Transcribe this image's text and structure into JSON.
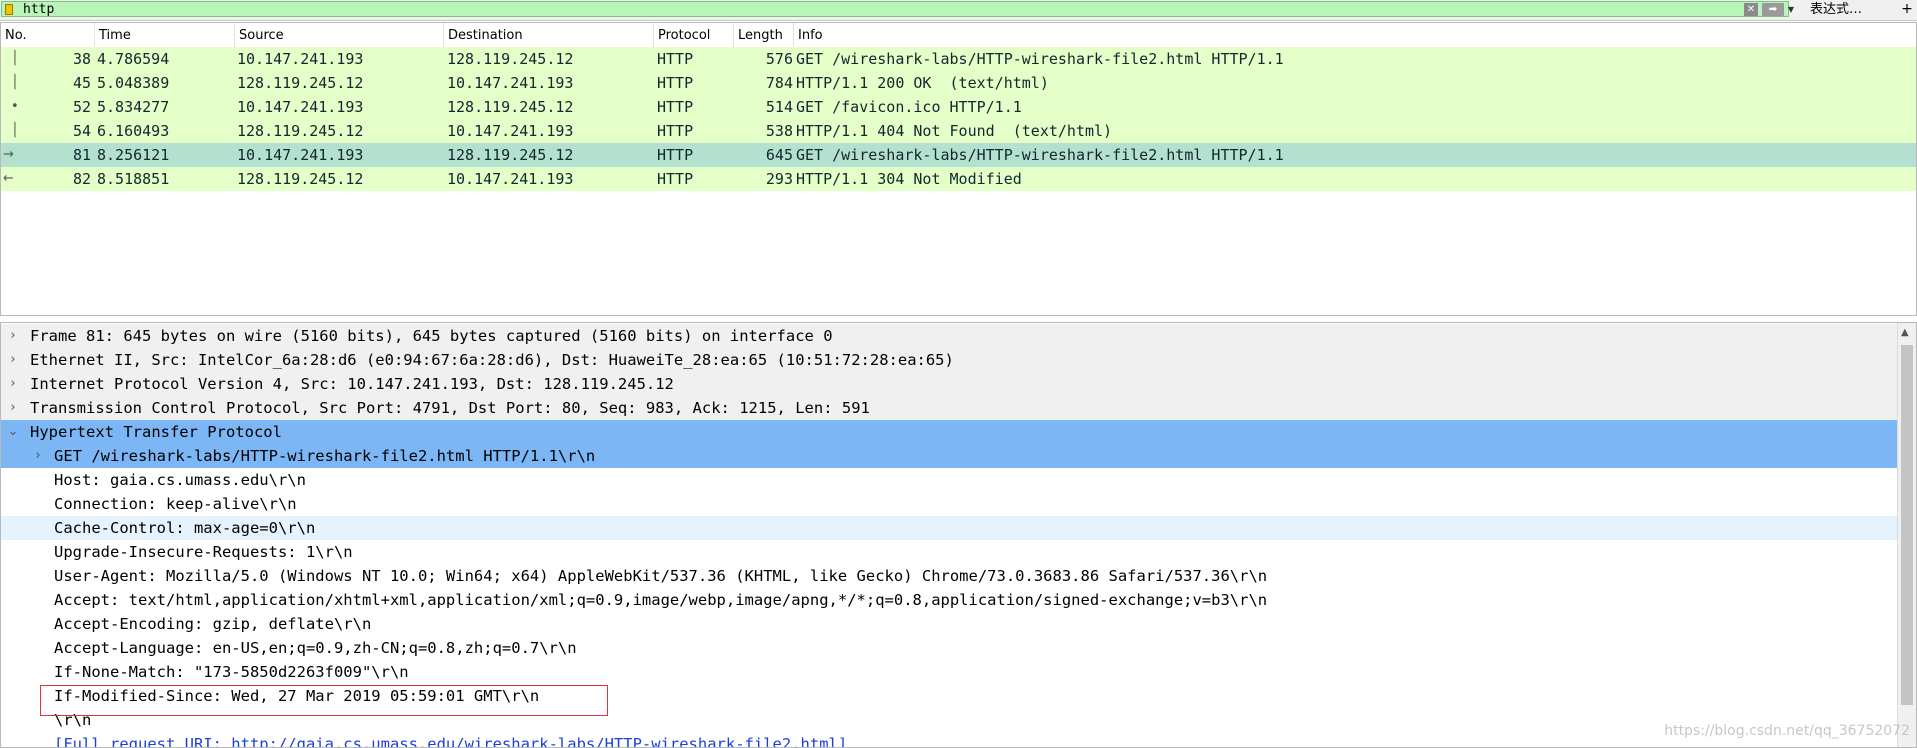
{
  "filter": {
    "value": "http",
    "expression_label": "表达式…",
    "add_label": "+"
  },
  "packet_list": {
    "columns": [
      "No.",
      "Time",
      "Source",
      "Destination",
      "Protocol",
      "Length",
      "Info"
    ],
    "rows": [
      {
        "no": "38",
        "time": "4.786594",
        "source": "10.147.241.193",
        "destination": "128.119.245.12",
        "protocol": "HTTP",
        "length": "576",
        "info": "GET /wireshark-labs/HTTP-wireshark-file2.html HTTP/1.1"
      },
      {
        "no": "45",
        "time": "5.048389",
        "source": "128.119.245.12",
        "destination": "10.147.241.193",
        "protocol": "HTTP",
        "length": "784",
        "info": "HTTP/1.1 200 OK  (text/html)"
      },
      {
        "no": "52",
        "time": "5.834277",
        "source": "10.147.241.193",
        "destination": "128.119.245.12",
        "protocol": "HTTP",
        "length": "514",
        "info": "GET /favicon.ico HTTP/1.1"
      },
      {
        "no": "54",
        "time": "6.160493",
        "source": "128.119.245.12",
        "destination": "10.147.241.193",
        "protocol": "HTTP",
        "length": "538",
        "info": "HTTP/1.1 404 Not Found  (text/html)"
      },
      {
        "no": "81",
        "time": "8.256121",
        "source": "10.147.241.193",
        "destination": "128.119.245.12",
        "protocol": "HTTP",
        "length": "645",
        "info": "GET /wireshark-labs/HTTP-wireshark-file2.html HTTP/1.1"
      },
      {
        "no": "82",
        "time": "8.518851",
        "source": "128.119.245.12",
        "destination": "10.147.241.193",
        "protocol": "HTTP",
        "length": "293",
        "info": "HTTP/1.1 304 Not Modified"
      }
    ]
  },
  "details": {
    "frame": "Frame 81: 645 bytes on wire (5160 bits), 645 bytes captured (5160 bits) on interface 0",
    "ethernet": "Ethernet II, Src: IntelCor_6a:28:d6 (e0:94:67:6a:28:d6), Dst: HuaweiTe_28:ea:65 (10:51:72:28:ea:65)",
    "ip": "Internet Protocol Version 4, Src: 10.147.241.193, Dst: 128.119.245.12",
    "tcp": "Transmission Control Protocol, Src Port: 4791, Dst Port: 80, Seq: 983, Ack: 1215, Len: 591",
    "http": "Hypertext Transfer Protocol",
    "request_line": "GET /wireshark-labs/HTTP-wireshark-file2.html HTTP/1.1\\r\\n",
    "headers": [
      "Host: gaia.cs.umass.edu\\r\\n",
      "Connection: keep-alive\\r\\n",
      "Cache-Control: max-age=0\\r\\n",
      "Upgrade-Insecure-Requests: 1\\r\\n",
      "User-Agent: Mozilla/5.0 (Windows NT 10.0; Win64; x64) AppleWebKit/537.36 (KHTML, like Gecko) Chrome/73.0.3683.86 Safari/537.36\\r\\n",
      "Accept: text/html,application/xhtml+xml,application/xml;q=0.9,image/webp,image/apng,*/*;q=0.8,application/signed-exchange;v=b3\\r\\n",
      "Accept-Encoding: gzip, deflate\\r\\n",
      "Accept-Language: en-US,en;q=0.9,zh-CN;q=0.8,zh;q=0.7\\r\\n",
      "If-None-Match: \"173-5850d2263f009\"\\r\\n",
      "If-Modified-Since: Wed, 27 Mar 2019 05:59:01 GMT\\r\\n",
      "\\r\\n",
      "[Full request URI: http://gaia.cs.umass.edu/wireshark-labs/HTTP-wireshark-file2.html]"
    ]
  },
  "watermark": "https://blog.csdn.net/qq_36752072",
  "colors": {
    "filter_bg": "#b9f5b9",
    "row_bg": "#e4ffc7",
    "row_selected": "#b3e0cf",
    "detail_selected": "#7cb6f5",
    "highlight_box": "#e0323c"
  }
}
